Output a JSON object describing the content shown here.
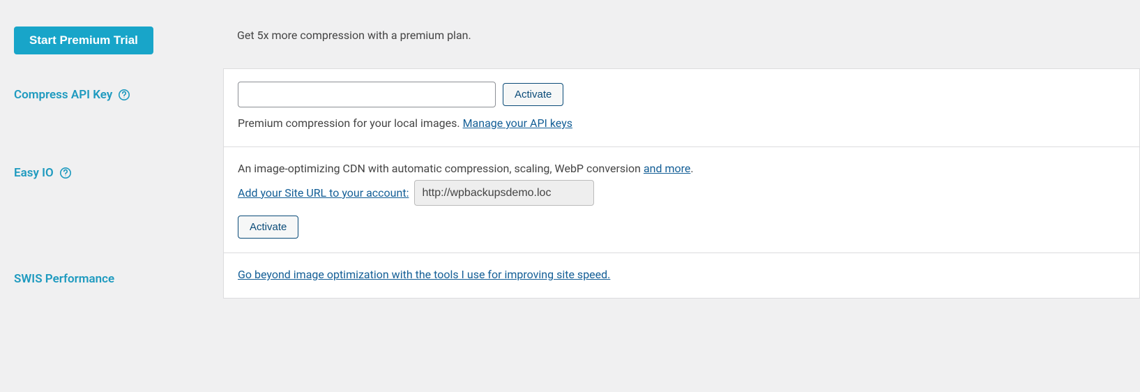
{
  "premium": {
    "button": "Start Premium Trial",
    "description": "Get 5x more compression with a premium plan."
  },
  "api_key": {
    "label": "Compress API Key",
    "input_value": "",
    "activate": "Activate",
    "desc_prefix": "Premium compression for your local images. ",
    "manage_link": "Manage your API keys"
  },
  "easy_io": {
    "label": "Easy IO",
    "desc_prefix": "An image-optimizing CDN with automatic compression, scaling, WebP conversion ",
    "and_more": "and more",
    "period": ".",
    "add_url_link": "Add your Site URL to your account:",
    "site_url": "http://wpbackupsdemo.loc",
    "activate": "Activate"
  },
  "swis": {
    "label": "SWIS Performance",
    "link_text": "Go beyond image optimization with the tools I use for improving site speed."
  }
}
